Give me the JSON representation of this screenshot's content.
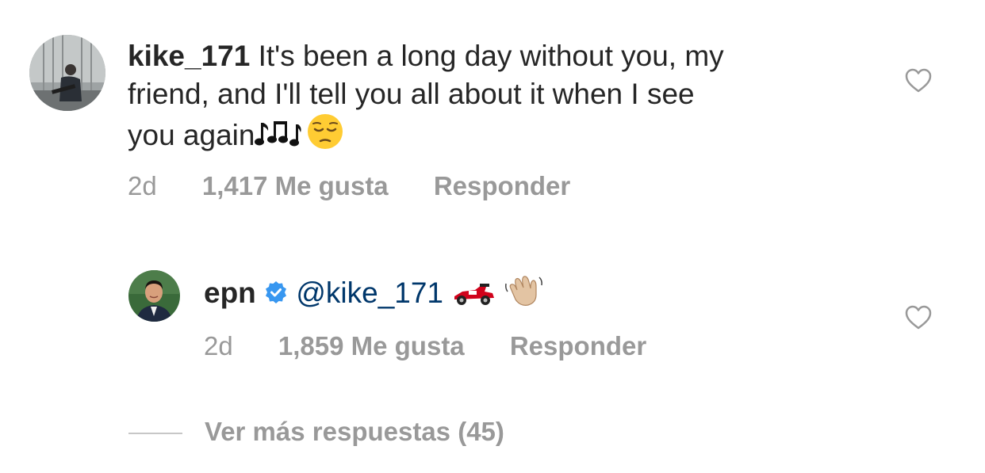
{
  "comment1": {
    "username": "kike_171",
    "text_line1": " It's been a long day without you, my",
    "text_line2": "friend, and I'll tell you all about it when I see",
    "text_line3": "you again",
    "emoji_icons": [
      "musical-notes-icon",
      "pensive-face-icon"
    ],
    "timestamp": "2d",
    "likes": "1,417 Me gusta",
    "reply": "Responder"
  },
  "comment2": {
    "username": "epn",
    "verified": true,
    "mention": "@kike_171",
    "emoji_icons": [
      "racing-car-icon",
      "waving-hand-icon"
    ],
    "timestamp": "2d",
    "likes": "1,859 Me gusta",
    "reply": "Responder"
  },
  "view_more": "Ver más respuestas (45)",
  "colors": {
    "text": "#262626",
    "secondary": "#999999",
    "mention": "#00376b",
    "verified": "#3897f0"
  }
}
